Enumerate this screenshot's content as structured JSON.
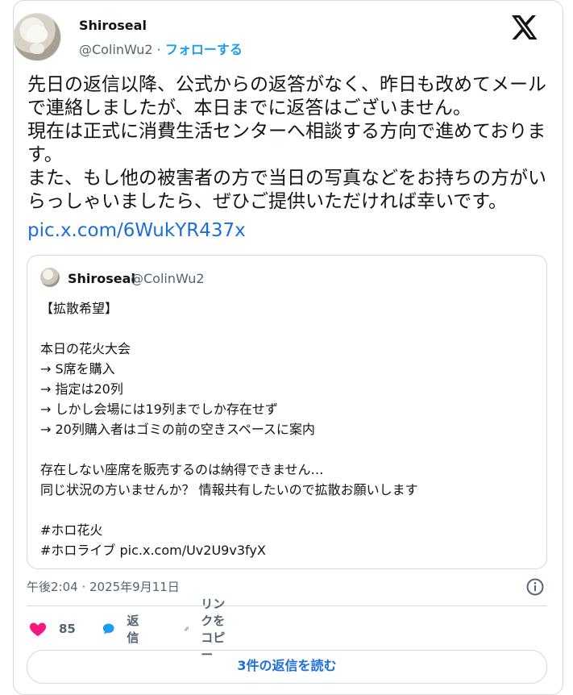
{
  "tweet": {
    "author_name": "Shiroseal",
    "author_handle": "@ColinWu2",
    "separator": "·",
    "follow_label": "フォローする",
    "text": "先日の返信以降、公式からの返答がなく、昨日も改めてメールで連絡しましたが、本日までに返答はございません。\n現在は正式に消費生活センターへ相談する方向で進めております。\nまた、もし他の被害者の方で当日の写真などをお持ちの方がいらっしゃいましたら、ぜひご提供いただければ幸いです。",
    "link": "pic.x.com/6WukYR437x",
    "timestamp": "午後2:04 · 2025年9月11日"
  },
  "quote": {
    "author_name": "Shiroseal",
    "author_handle": "@ColinWu2",
    "text": "【拡散希望】\n\n本日の花火大会\n→ S席を購入\n→ 指定は20列\n→ しかし会場には19列までしか存在せず\n→ 20列購入者はゴミの前の空きスペースに案内\n\n存在しない座席を販売するのは納得できません…\n同じ状況の方いませんか？ 情報共有したいので拡散お願いします\n\n#ホロ花火\n#ホロライブ pic.x.com/Uv2U9v3fyX"
  },
  "actions": {
    "like_count": "85",
    "reply_label": "返信",
    "copy_link_label": "リンクをコピー"
  },
  "read_replies_label": "3件の返信を読む",
  "icons": {
    "logo": "x-logo-icon",
    "info": "info-icon",
    "like": "heart-icon",
    "reply": "speech-bubble-icon",
    "copy": "link-icon"
  },
  "colors": {
    "accent": "#1d9bf0",
    "link": "#1d6ed8",
    "like": "#f91880",
    "secondary_text": "#536471",
    "border": "#cfd9de"
  }
}
